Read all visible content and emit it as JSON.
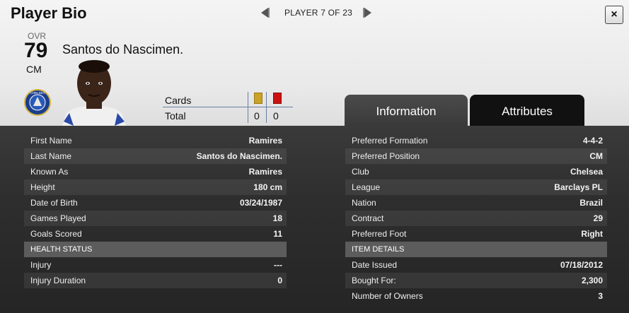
{
  "header": {
    "title": "Player Bio",
    "nav_label": "PLAYER 7 OF 23",
    "close_label": "×"
  },
  "player": {
    "ovr_label": "OVR",
    "ovr": "79",
    "position": "CM",
    "name": "Santos do Nascimen."
  },
  "cards": {
    "label": "Cards",
    "total_label": "Total",
    "yellow": "0",
    "red": "0",
    "yellow_color": "#c9a227",
    "red_color": "#cc1111"
  },
  "tabs": {
    "information": "Information",
    "attributes": "Attributes"
  },
  "left": {
    "rows": [
      {
        "k": "First Name",
        "v": "Ramires"
      },
      {
        "k": "Last Name",
        "v": "Santos do Nascimen."
      },
      {
        "k": "Known As",
        "v": "Ramires"
      },
      {
        "k": "Height",
        "v": "180 cm"
      },
      {
        "k": "Date of Birth",
        "v": "03/24/1987"
      },
      {
        "k": "Games Played",
        "v": "18"
      },
      {
        "k": "Goals Scored",
        "v": "11"
      }
    ],
    "health_header": "HEALTH STATUS",
    "health_rows": [
      {
        "k": "Injury",
        "v": "---"
      },
      {
        "k": "Injury Duration",
        "v": "0"
      }
    ]
  },
  "right": {
    "rows": [
      {
        "k": "Preferred Formation",
        "v": "4-4-2"
      },
      {
        "k": "Preferred Position",
        "v": "CM"
      },
      {
        "k": "Club",
        "v": "Chelsea"
      },
      {
        "k": "League",
        "v": "Barclays PL"
      },
      {
        "k": "Nation",
        "v": "Brazil"
      },
      {
        "k": "Contract",
        "v": "29"
      },
      {
        "k": "Preferred Foot",
        "v": "Right"
      }
    ],
    "item_header": "ITEM DETAILS",
    "item_rows": [
      {
        "k": "Date Issued",
        "v": "07/18/2012"
      },
      {
        "k": "Bought For:",
        "v": "2,300"
      },
      {
        "k": "Number of Owners",
        "v": "3"
      }
    ]
  },
  "badge": {
    "text": "CHELSEA"
  }
}
